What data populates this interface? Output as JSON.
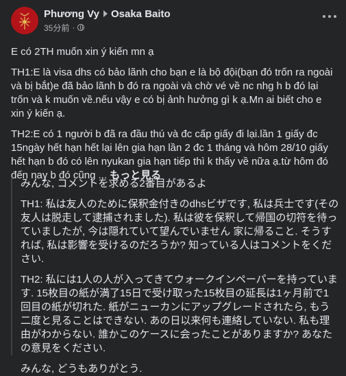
{
  "author": "Phương Vy",
  "group": "Osaka Baito",
  "timestamp": "35分前",
  "privacy_icon": "globe-icon",
  "more_icon": "more-options-icon",
  "post": {
    "line1": "E có 2TH muốn xin ý kiến mn ạ",
    "th1": "TH1:E là visa dhs có bảo lãnh cho bạn e là bộ đội(bạn đó trốn ra ngoài và bị bắt)e đã bảo lãnh b đó ra ngoài và chờ vé về nc nhg h b đó lại trốn và k muốn về.nếu vậy e có bị ảnh hưởng gì k ạ.Mn ai biết cho e xin ý kiến ạ.",
    "th2": "TH2:E có 1 người b đã ra đầu thú và đc cấp giấy đi lại.lần 1 giấy đc 15ngày hết hạn hết lại lên gia hạn lần 2 đc 1 tháng và hôm 28/10 giấy hết hạn b đó có lên nyukan gia hạn tiếp thì k thấy về nữa ạ.từ hôm đó đến nay b đó cũng ...",
    "see_more": "もっと見る"
  },
  "translation": {
    "line1": "みんな, コメントを求める2番目があるよ",
    "th1": "TH1: 私は友人のために保釈金付きのdhsビザです, 私は兵士です(その友人は脱走して逮捕されました). 私は彼を保釈して帰国の切符を待っていましたが, 今は隠れていて望んでいません 家に帰ること. そうすれば, 私は影響を受けるのだろうか? 知っている人はコメントをください.",
    "th2": "TH2: 私には1人の人が入ってきてウォークインペーパーを持っています. 15枚目の紙が満了15日で受け取った15枚目の延長は1ヶ月前で1回目の紙が切れた. 紙がニューカンにアップグレードされたら, もう二度と見ることはできない. あの日以来何も連絡していない. 私も理由がわからない. 誰かこのケースに会ったことがありますか? あなたの意見をください.",
    "thanks": "みんな, どうもありがとう."
  }
}
